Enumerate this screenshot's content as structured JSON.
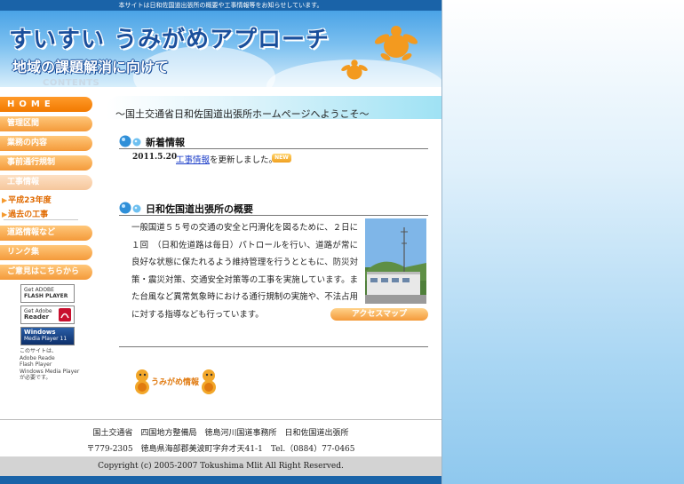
{
  "topbar": {
    "text": "本サイトは日和佐国道出張所の概要や工事情報等をお知らせしています。"
  },
  "header": {
    "title": "すいすい うみがめアプローチ",
    "subtitle": "地域の課題解消に向けて",
    "contents_label": "CONTENTS"
  },
  "sidebar": {
    "home": "HOME",
    "items": [
      "管理区間",
      "業務の内容",
      "事前通行規制",
      "工事情報"
    ],
    "sub_items": [
      "平成23年度",
      "過去の工事"
    ],
    "items2": [
      "道路情報など",
      "リンク集",
      "ご意見はこちらから"
    ],
    "badges": {
      "flash_line1": "Get ADOBE",
      "flash_line2": "FLASH PLAYER",
      "reader_line1": "Get Adobe",
      "reader_line2": "Reader",
      "wmp_line1": "Windows",
      "wmp_line2": "Media Player 11"
    },
    "plugin_note": [
      "このサイトは、",
      "Adobe Reade",
      "Flash Player",
      "Windows Media Player",
      "が必要です。"
    ]
  },
  "main": {
    "welcome": "〜国土交通省日和佐国道出張所ホームページへようこそ〜",
    "news": {
      "heading": "新着情報",
      "date": "2011.5.20",
      "link_text": "工事情報",
      "text_suffix": "を更新しました。",
      "new_badge": "NEW"
    },
    "overview": {
      "heading": "日和佐国道出張所の概要",
      "body": "一般国道５５号の交通の安全と円滑化を図るために、２日に１回　（日和佐道路は毎日）パトロールを行い、道路が常に良好な状態に保たれるよう維持管理を行うとともに、防災対策・震災対策、交通安全対策等の工事を実施しています。また台風など異常気象時における通行規制の実施や、不法占用に対する指導なども行っています。",
      "access_button": "アクセスマップ"
    },
    "umigame_banner": "うみがめ情報"
  },
  "footer": {
    "address1": "国土交通省　四国地方整備局　徳島河川国道事務所　日和佐国道出張所",
    "address2": "〒779-2305　徳島県海部郡美波町字弁才天41-1　Tel.（0884）77-0465",
    "copyright": "Copyright (c) 2005-2007 Tokushima Mlit All Right Reserved."
  },
  "colors": {
    "brand_blue": "#1a63a8",
    "nav_orange": "#f49a3a",
    "home_orange": "#f27a00",
    "turtle_orange": "#f39a1f"
  }
}
